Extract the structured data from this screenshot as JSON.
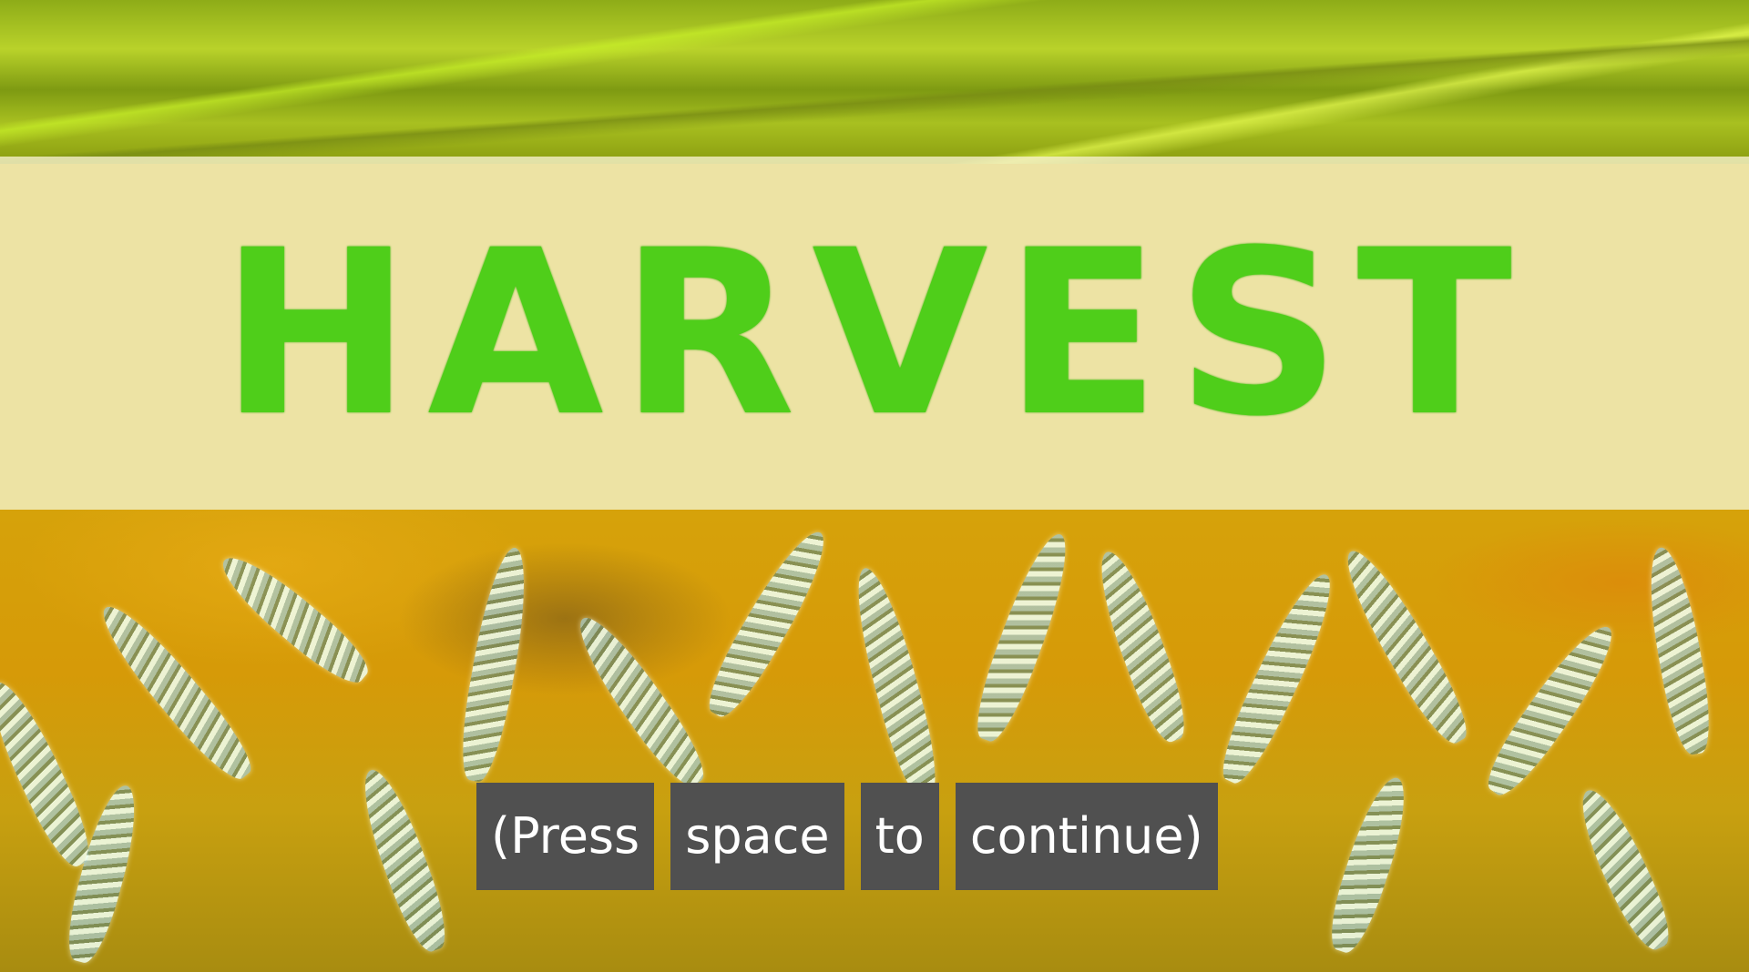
{
  "game": {
    "title": "HARVEST",
    "prompt_words": [
      "(Press",
      "space",
      "to",
      "continue)"
    ]
  },
  "colors": {
    "title_green": "#4fce1a",
    "banner": "#f5f0c8",
    "prompt_box": "#505050",
    "field_gold": "#d69a08"
  }
}
